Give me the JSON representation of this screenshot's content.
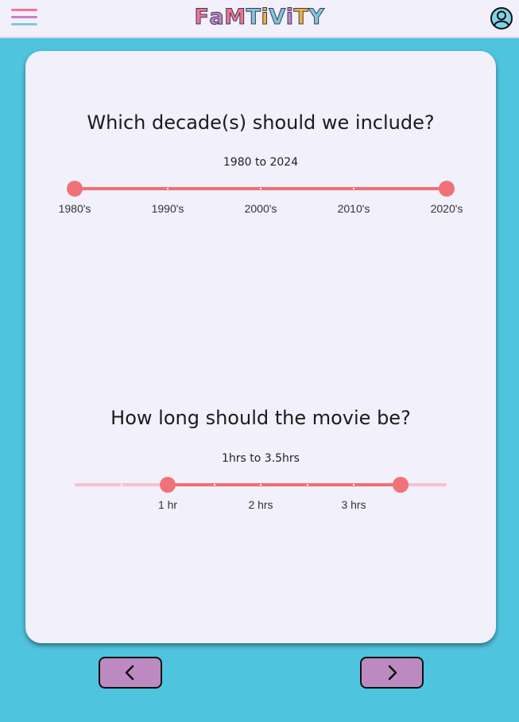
{
  "header": {
    "logo": "FaMTiViTY",
    "menu_icon": "hamburger-menu-icon",
    "profile_icon": "user-profile-icon"
  },
  "colors": {
    "background": "#4fc4df",
    "card": "#f1f0fb",
    "accent": "#ef6f75",
    "track_inactive": "#f6c3cb",
    "button": "#bc8ac1",
    "logo_letters": [
      "#f07590",
      "#c084c6",
      "#f07590",
      "#7fc8dc",
      "#f2b134",
      "#7fc8dc",
      "#c084c6",
      "#f2b134",
      "#7fc8dc"
    ]
  },
  "decade_question": {
    "title": "Which decade(s) should we include?",
    "range_text": "1980 to 2024",
    "tick_labels": [
      "1980's",
      "1990's",
      "2000's",
      "2010's",
      "2020's"
    ],
    "min_index": 0,
    "max_index": 4,
    "selected_low_index": 0,
    "selected_high_index": 4
  },
  "length_question": {
    "title": "How long should the movie be?",
    "range_text": "1hrs to 3.5hrs",
    "tick_labels": [
      "1 hr",
      "2 hrs",
      "3 hrs"
    ],
    "min_hours": 0,
    "max_hours": 4,
    "step_hours": 0.5,
    "labeled_hours": [
      1,
      2,
      3
    ],
    "selected_low_hours": 1,
    "selected_high_hours": 3.5
  },
  "navigation": {
    "prev_icon": "chevron-left-icon",
    "next_icon": "chevron-right-icon"
  }
}
